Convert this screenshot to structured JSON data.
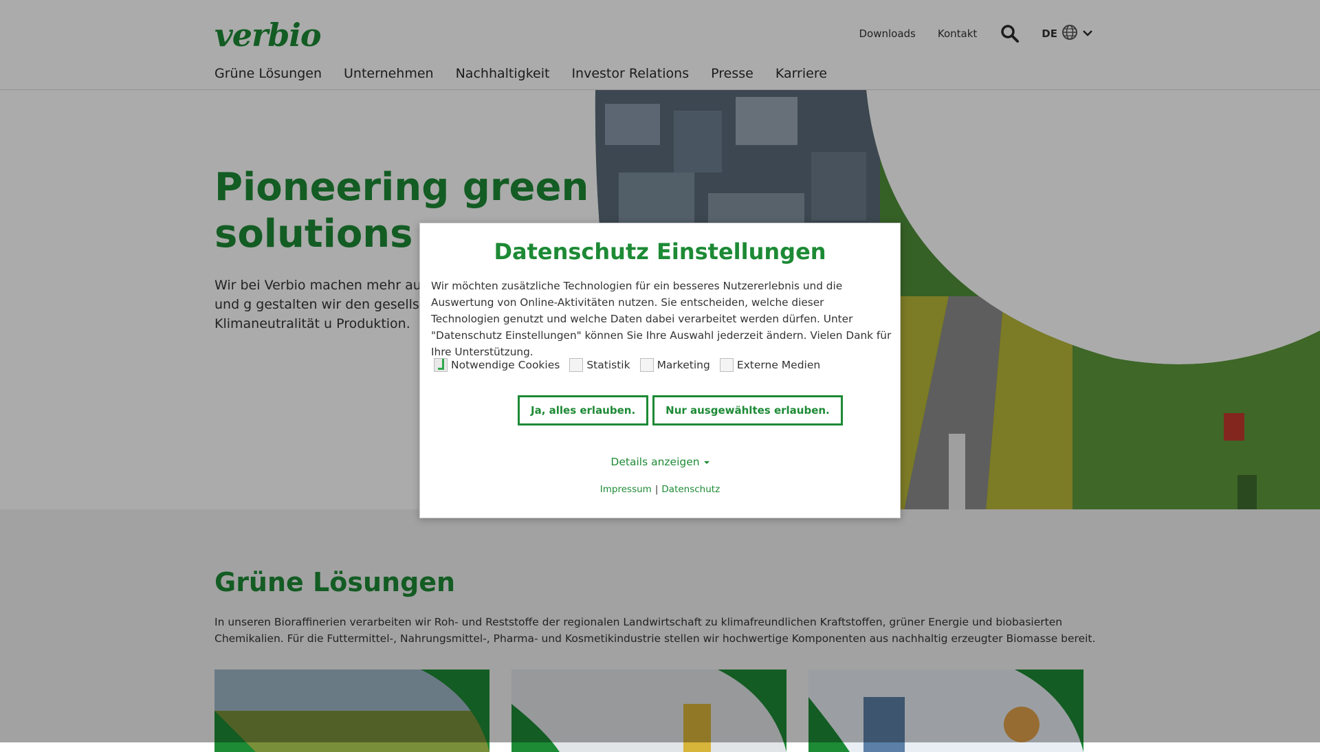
{
  "header": {
    "logo": "verbio",
    "utility": {
      "downloads": "Downloads",
      "contact": "Kontakt",
      "lang": "DE"
    },
    "nav": [
      "Grüne Lösungen",
      "Unternehmen",
      "Nachhaltigkeit",
      "Investor Relations",
      "Presse",
      "Karriere"
    ]
  },
  "hero": {
    "title": "Pioneering green solutions",
    "text": "Wir bei Verbio machen mehr aus innovativen Technologien und g gestalten wir den gesellschaftlic Wandel hin zu Klimaneutralität u Produktion."
  },
  "section2": {
    "title": "Grüne Lösungen",
    "text": "In unseren Bioraffinerien verarbeiten wir Roh- und Reststoffe der regionalen Landwirtschaft zu klimafreundlichen Kraftstoffen, grüner Energie und biobasierten Chemikalien. Für die Futtermittel-, Nahrungsmittel-, Pharma- und Kosmetikindustrie stellen wir hochwertige Komponenten aus nachhaltig erzeugter Biomasse bereit."
  },
  "modal": {
    "title": "Datenschutz Einstellungen",
    "text": "Wir möchten zusätzliche Technologien für ein besseres Nutzererlebnis und die Auswertung von Online-Aktivitäten nutzen. Sie entscheiden, welche dieser Technologien genutzt und welche Daten dabei verarbeitet werden dürfen. Unter \"Datenschutz  Einstellungen\" können Sie Ihre Auswahl jederzeit ändern. Vielen Dank für Ihre Unterstützung.",
    "checkboxes": [
      {
        "label": "Notwendige Cookies",
        "checked": true
      },
      {
        "label": "Statistik",
        "checked": false
      },
      {
        "label": "Marketing",
        "checked": false
      },
      {
        "label": "Externe Medien",
        "checked": false
      }
    ],
    "btn_all": "Ja, alles erlauben.",
    "btn_selected": "Nur ausgewähltes erlauben.",
    "details": "Details anzeigen",
    "impressum": "Impressum",
    "separator": "|",
    "datenschutz": "Datenschutz"
  },
  "colors": {
    "brand_green": "#1d8a35",
    "check_green": "#2ea84a"
  }
}
